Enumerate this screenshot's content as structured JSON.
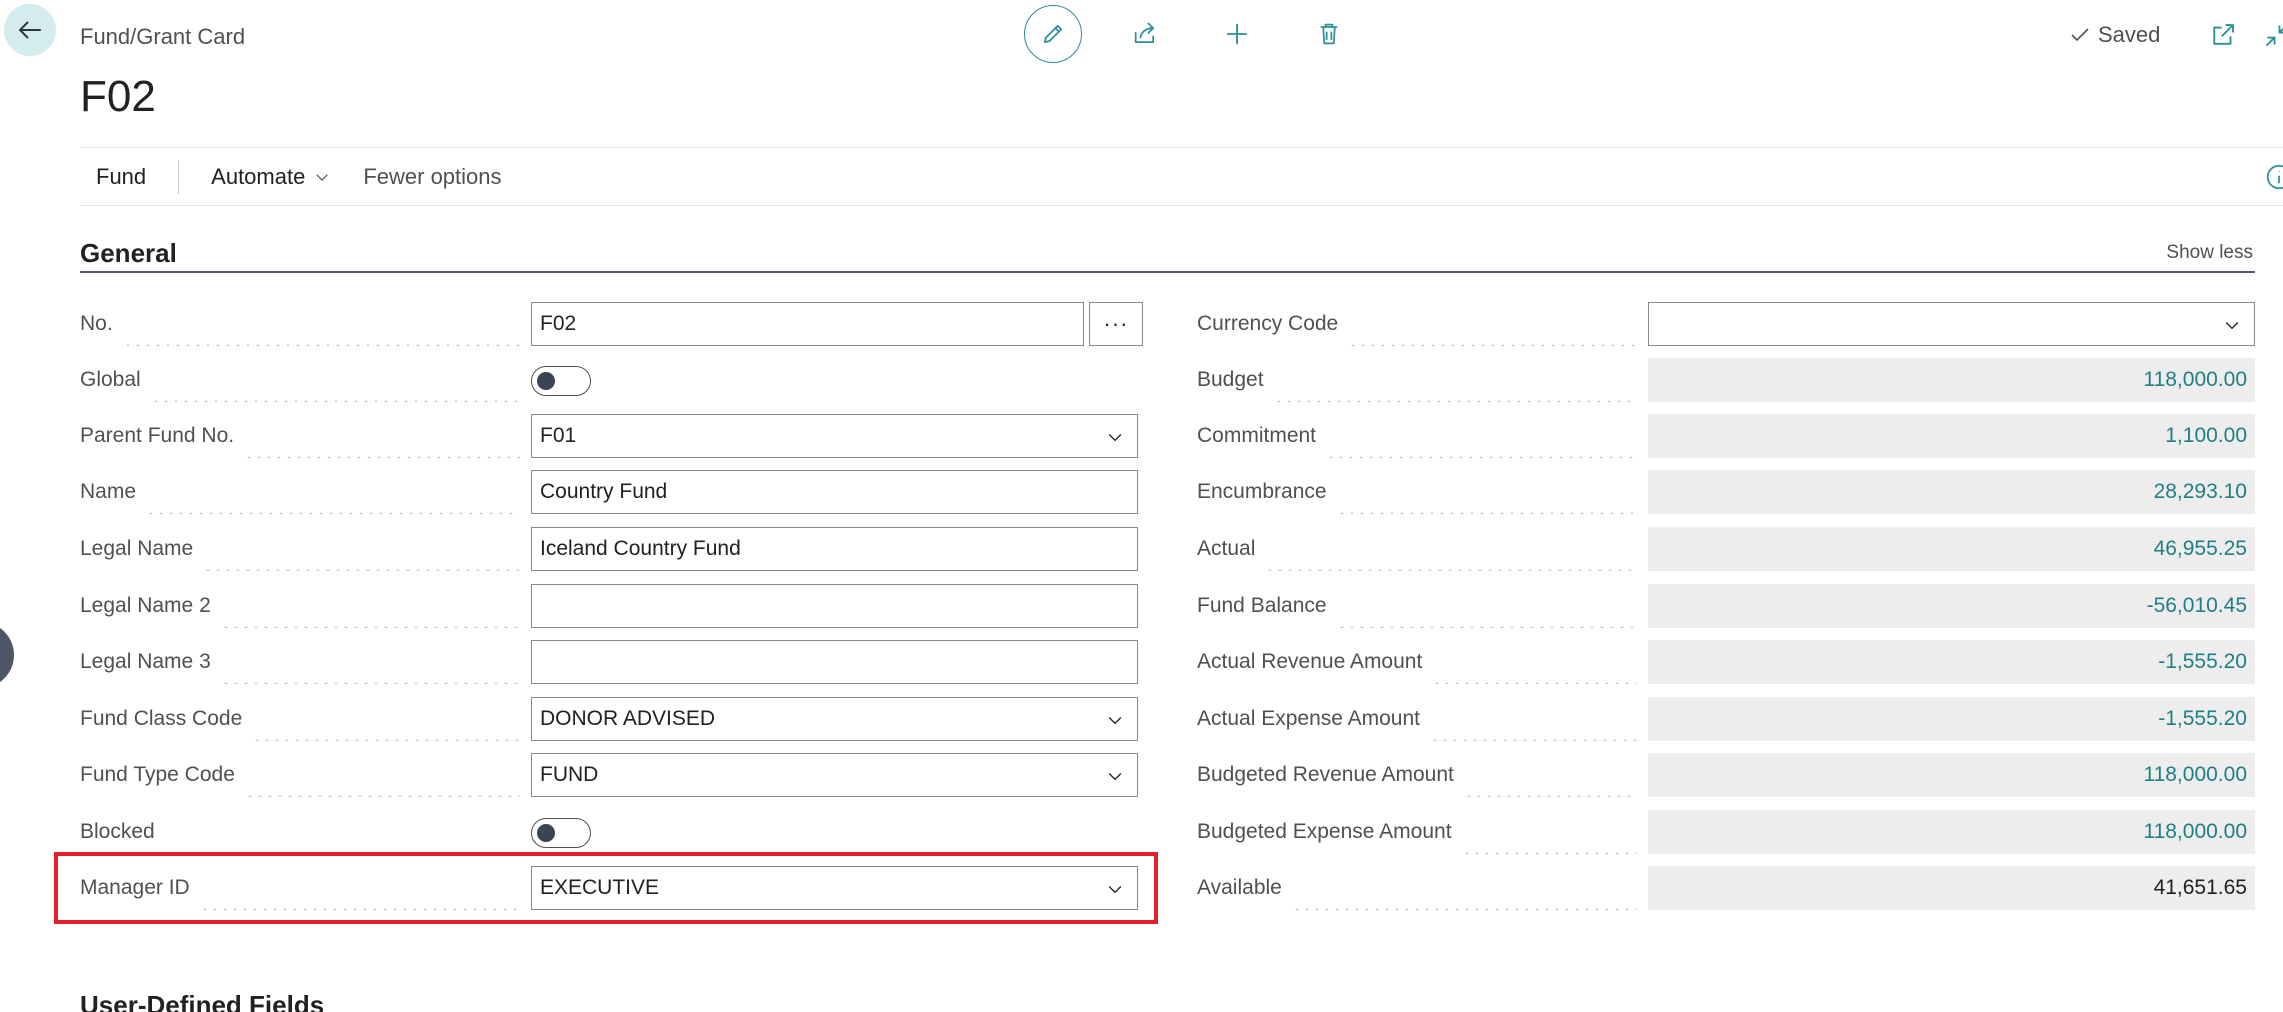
{
  "header": {
    "breadcrumb": "Fund/Grant Card",
    "title": "F02",
    "saved_label": "Saved"
  },
  "actions": {
    "fund": "Fund",
    "automate": "Automate",
    "fewer_options": "Fewer options"
  },
  "section": {
    "title": "General",
    "show_less": "Show less"
  },
  "left_fields": {
    "no": {
      "label": "No.",
      "value": "F02"
    },
    "global": {
      "label": "Global",
      "value": false
    },
    "parent_fund_no": {
      "label": "Parent Fund No.",
      "value": "F01"
    },
    "name": {
      "label": "Name",
      "value": "Country Fund"
    },
    "legal_name": {
      "label": "Legal Name",
      "value": "Iceland Country Fund"
    },
    "legal_name_2": {
      "label": "Legal Name 2",
      "value": ""
    },
    "legal_name_3": {
      "label": "Legal Name 3",
      "value": ""
    },
    "fund_class_code": {
      "label": "Fund Class Code",
      "value": "DONOR ADVISED"
    },
    "fund_type_code": {
      "label": "Fund Type Code",
      "value": "FUND"
    },
    "blocked": {
      "label": "Blocked",
      "value": false
    },
    "manager_id": {
      "label": "Manager ID",
      "value": "EXECUTIVE"
    }
  },
  "right_fields": {
    "currency_code": {
      "label": "Currency Code",
      "value": ""
    },
    "budget": {
      "label": "Budget",
      "value": "118,000.00"
    },
    "commitment": {
      "label": "Commitment",
      "value": "1,100.00"
    },
    "encumbrance": {
      "label": "Encumbrance",
      "value": "28,293.10"
    },
    "actual": {
      "label": "Actual",
      "value": "46,955.25"
    },
    "fund_balance": {
      "label": "Fund Balance",
      "value": "-56,010.45"
    },
    "actual_revenue_amount": {
      "label": "Actual Revenue Amount",
      "value": "-1,555.20"
    },
    "actual_expense_amount": {
      "label": "Actual Expense Amount",
      "value": "-1,555.20"
    },
    "budgeted_revenue_amount": {
      "label": "Budgeted Revenue Amount",
      "value": "118,000.00"
    },
    "budgeted_expense_amount": {
      "label": "Budgeted Expense Amount",
      "value": "118,000.00"
    },
    "available": {
      "label": "Available",
      "value": "41,651.65"
    }
  },
  "next_section": {
    "title": "User-Defined Fields"
  },
  "colors": {
    "accent": "#2a8f97",
    "link_value": "#1f7f86",
    "highlight": "#e0202a"
  }
}
